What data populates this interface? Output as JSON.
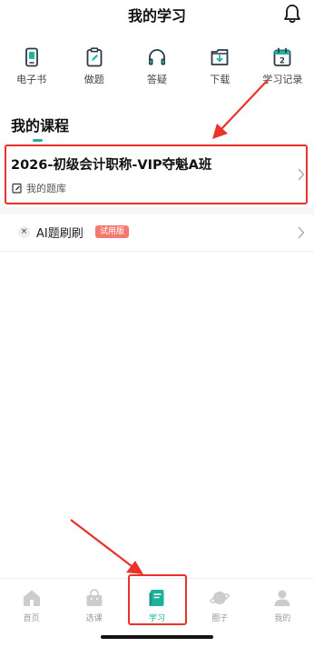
{
  "header": {
    "title": "我的学习",
    "bell_icon": "bell-icon"
  },
  "quick_nav": [
    {
      "label": "电子书",
      "icon": "ebook-icon"
    },
    {
      "label": "做题",
      "icon": "exercise-icon"
    },
    {
      "label": "答疑",
      "icon": "headphones-icon"
    },
    {
      "label": "下载",
      "icon": "download-icon"
    },
    {
      "label": "学习记录",
      "icon": "calendar-icon",
      "badge": "2"
    }
  ],
  "courses": {
    "title": "我的课程",
    "item": {
      "name": "2026-初级会计职称-VIP夺魁A班",
      "sub_label": "我的题库"
    }
  },
  "ai": {
    "label": "AI题刷刷",
    "badge": "试用版",
    "icon_glyph": "×"
  },
  "tabbar": [
    {
      "label": "首页",
      "icon": "home-icon"
    },
    {
      "label": "选课",
      "icon": "shop-bag-icon"
    },
    {
      "label": "学习",
      "icon": "book-icon",
      "active": true
    },
    {
      "label": "圈子",
      "icon": "planet-icon"
    },
    {
      "label": "我的",
      "icon": "profile-icon"
    }
  ],
  "colors": {
    "accent": "#1bb19c",
    "annotation": "#e8322a",
    "badge": "#f37a70",
    "tab_inactive": "#cccccc"
  }
}
